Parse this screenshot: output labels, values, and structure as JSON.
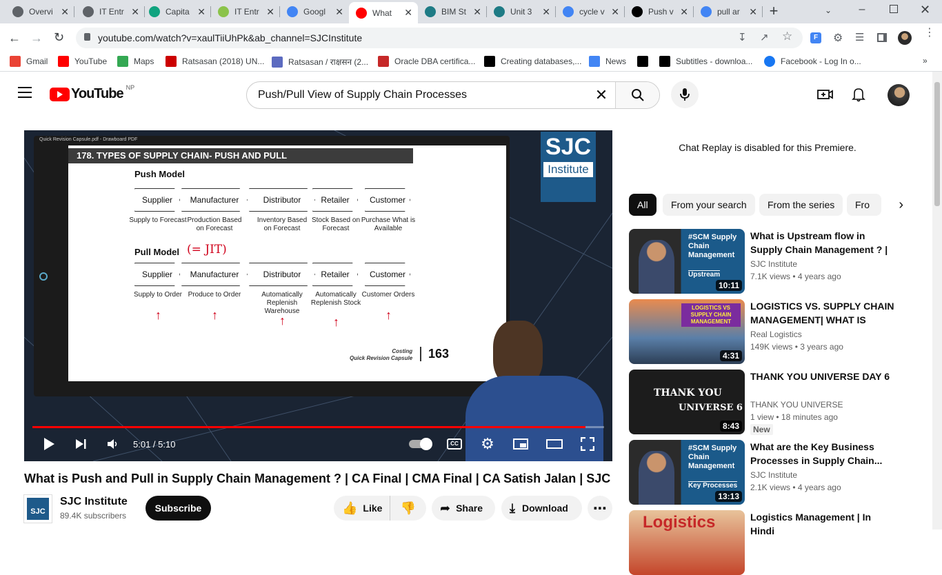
{
  "browser": {
    "tabs": [
      {
        "label": "Overvi",
        "icon": "globe-icon",
        "color": "#5f6368"
      },
      {
        "label": "IT Entr",
        "icon": "globe-icon",
        "color": "#5f6368"
      },
      {
        "label": "Capita",
        "icon": "openai-icon",
        "color": "#10a37f"
      },
      {
        "label": "IT Entr",
        "icon": "app-icon",
        "color": "#8bc34a"
      },
      {
        "label": "Googl",
        "icon": "google-lens-icon",
        "color": "#4285f4"
      },
      {
        "label": "What",
        "icon": "youtube-icon",
        "color": "#ff0000"
      },
      {
        "label": "BIM St",
        "icon": "scribd-icon",
        "color": "#1e7b85"
      },
      {
        "label": "Unit 3",
        "icon": "scribd-icon",
        "color": "#1e7b85"
      },
      {
        "label": "cycle v",
        "icon": "google-icon",
        "color": "#4285f4"
      },
      {
        "label": "Push v",
        "icon": "chegg-icon",
        "color": "#000000"
      },
      {
        "label": "pull ar",
        "icon": "google-icon",
        "color": "#4285f4"
      }
    ],
    "new_tab": "+",
    "url": "youtube.com/watch?v=xaulTiiUhPk&ab_channel=SJCInstitute",
    "bookmarks": [
      {
        "label": "Gmail",
        "icon": "gmail-icon"
      },
      {
        "label": "YouTube",
        "icon": "youtube-icon"
      },
      {
        "label": "Maps",
        "icon": "maps-icon"
      },
      {
        "label": "Ratsasan (2018) UN...",
        "icon": "hd-icon"
      },
      {
        "label": "Ratsasan / राक्षसन (2...",
        "icon": "swirl-icon"
      },
      {
        "label": "Oracle DBA certifica...",
        "icon": "du-icon"
      },
      {
        "label": "Creating databases,...",
        "icon": "x-icon"
      },
      {
        "label": "News",
        "icon": "google-news-icon"
      },
      {
        "label": "",
        "icon": "oe-icon"
      },
      {
        "label": "Subtitles - downloa...",
        "icon": "oe-icon"
      },
      {
        "label": "Facebook - Log In o...",
        "icon": "facebook-icon"
      }
    ]
  },
  "youtube": {
    "logo_text": "YouTube",
    "region": "NP",
    "search_query": "Push/Pull View of Supply Chain Processes"
  },
  "player": {
    "time": "5:01 / 5:10",
    "progress_fraction": 0.968,
    "slide": {
      "window_title": "Quick Revision Capsule.pdf - Drawboard PDF",
      "heading": "178. TYPES OF SUPPLY CHAIN- PUSH AND PULL",
      "push_label": "Push Model",
      "pull_label": "Pull Model",
      "annotation": "(= JIT)",
      "push_boxes": [
        "Supplier",
        "Manufacturer",
        "Distributor",
        "Retailer",
        "Customer"
      ],
      "push_captions": [
        "Supply to Forecast",
        "Production Based on Forecast",
        "Inventory Based on Forecast",
        "Stock Based on Forecast",
        "Purchase What is Available"
      ],
      "pull_boxes": [
        "Supplier",
        "Manufacturer",
        "Distributor",
        "Retailer",
        "Customer"
      ],
      "pull_captions": [
        "Supply to Order",
        "Produce to Order",
        "Automatically Replenish Warehouse",
        "Automatically Replenish Stock",
        "Customer Orders"
      ],
      "footer_line1": "Costing",
      "footer_line2": "Quick Revision Capsule",
      "page_number": "163"
    },
    "watermark": {
      "line1": "SJC",
      "line2": "Institute"
    }
  },
  "video": {
    "title": "What is Push and Pull in Supply Chain Management ? | CA Final | CMA Final | CA Satish Jalan | SJC",
    "channel": "SJC Institute",
    "subscribers": "89.4K subscribers",
    "subscribe_label": "Subscribe",
    "like_label": "Like",
    "share_label": "Share",
    "download_label": "Download"
  },
  "sidebar": {
    "chat_message": "Chat Replay is disabled for this Premiere.",
    "chips": [
      "All",
      "From your search",
      "From the series",
      "Fro"
    ],
    "recommendations": [
      {
        "title": "What is Upstream flow in Supply Chain Management ? | CA Fina...",
        "channel": "SJC Institute",
        "views": "7.1K views",
        "age": "4 years ago",
        "duration": "10:11",
        "thumb_text": "#SCM Supply Chain Management",
        "thumb_sub": "Upstream",
        "new": ""
      },
      {
        "title": "LOGISTICS VS. SUPPLY CHAIN MANAGEMENT| WHAT IS THE...",
        "channel": "Real Logistics",
        "views": "149K views",
        "age": "3 years ago",
        "duration": "4:31",
        "thumb_text": "LOGISTICS VS SUPPLY CHAIN MANAGEMENT",
        "thumb_sub": "",
        "new": ""
      },
      {
        "title": "THANK YOU UNIVERSE DAY 6",
        "channel": "THANK YOU UNIVERSE",
        "views": "1 view",
        "age": "18 minutes ago",
        "duration": "8:43",
        "thumb_text": "THANK YOU",
        "thumb_sub": "UNIVERSE 6",
        "new": "New"
      },
      {
        "title": "What are the Key Business Processes in Supply Chain...",
        "channel": "SJC Institute",
        "views": "2.1K views",
        "age": "4 years ago",
        "duration": "13:13",
        "thumb_text": "#SCM Supply Chain Management",
        "thumb_sub": "Key Processes",
        "new": ""
      },
      {
        "title": "Logistics Management | In Hindi",
        "channel": "",
        "views": "",
        "age": "",
        "duration": "",
        "thumb_text": "Logistics",
        "thumb_sub": "",
        "new": ""
      }
    ]
  },
  "colors": {
    "accent": "#ff0000",
    "chrome_bg": "#dee1e6",
    "subscribe_bg": "#0f0f0f",
    "sjc_blue": "#1e5a8a"
  }
}
